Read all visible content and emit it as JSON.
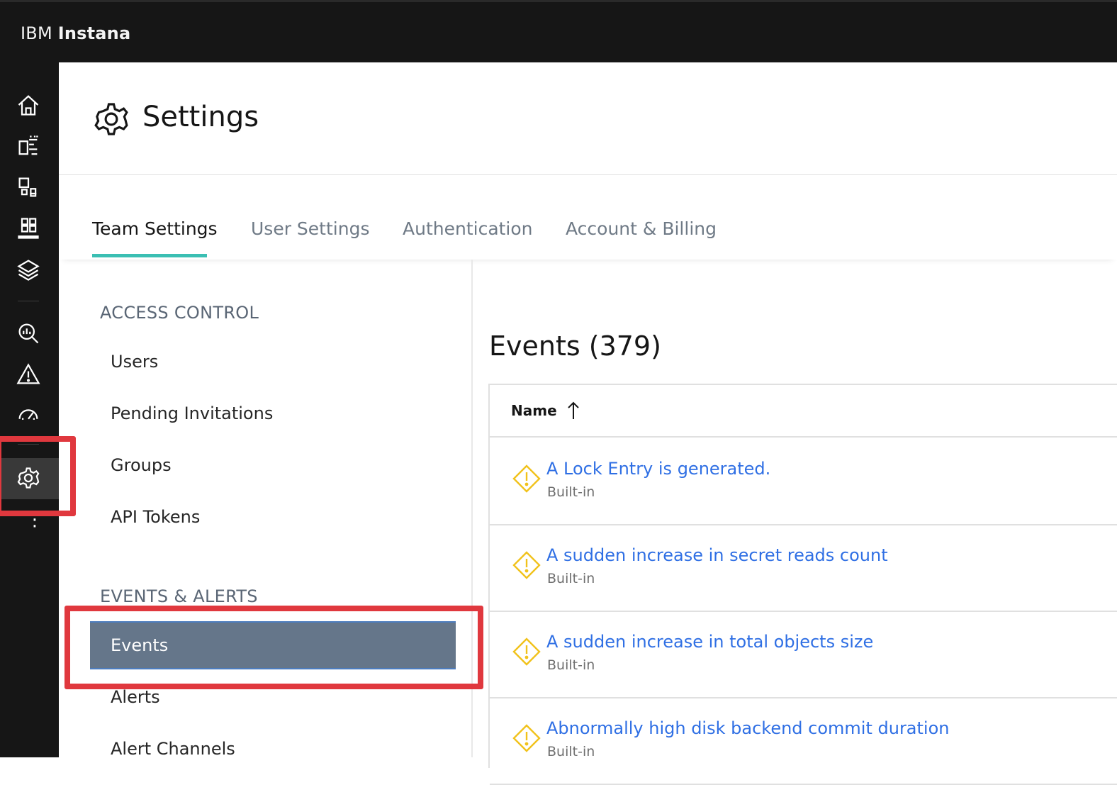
{
  "app": {
    "brand_prefix": "IBM",
    "brand_name": "Instana"
  },
  "rail": {
    "icons": [
      "home-icon",
      "applications-icon",
      "platforms-icon",
      "infrastructure-icon",
      "stack-icon",
      "analytics-icon",
      "alert-icon",
      "synthetics-icon",
      "settings-icon",
      "more-icon"
    ]
  },
  "header": {
    "title": "Settings"
  },
  "tabs": [
    {
      "label": "Team Settings",
      "active": true
    },
    {
      "label": "User Settings",
      "active": false
    },
    {
      "label": "Authentication",
      "active": false
    },
    {
      "label": "Account & Billing",
      "active": false
    }
  ],
  "sidemenu": {
    "sections": [
      {
        "title": "ACCESS CONTROL",
        "items": [
          "Users",
          "Pending Invitations",
          "Groups",
          "API Tokens"
        ]
      },
      {
        "title": "EVENTS & ALERTS",
        "items": [
          "Events",
          "Alerts",
          "Alert Channels"
        ]
      }
    ],
    "active_item": "Events"
  },
  "content": {
    "title": "Events (379)",
    "table": {
      "column_name": "Name",
      "sort": "ascending",
      "rows": [
        {
          "name": "A Lock Entry is generated.",
          "type": "Built-in"
        },
        {
          "name": "A sudden increase in secret reads count",
          "type": "Built-in"
        },
        {
          "name": "A sudden increase in total objects size",
          "type": "Built-in"
        },
        {
          "name": "Abnormally high disk backend commit duration",
          "type": "Built-in"
        }
      ]
    }
  },
  "colors": {
    "accent": "#3bbfb3",
    "link": "#2f6fe4",
    "warning": "#f1c21b",
    "highlight": "#e0383e",
    "active_menu": "#65768a"
  }
}
